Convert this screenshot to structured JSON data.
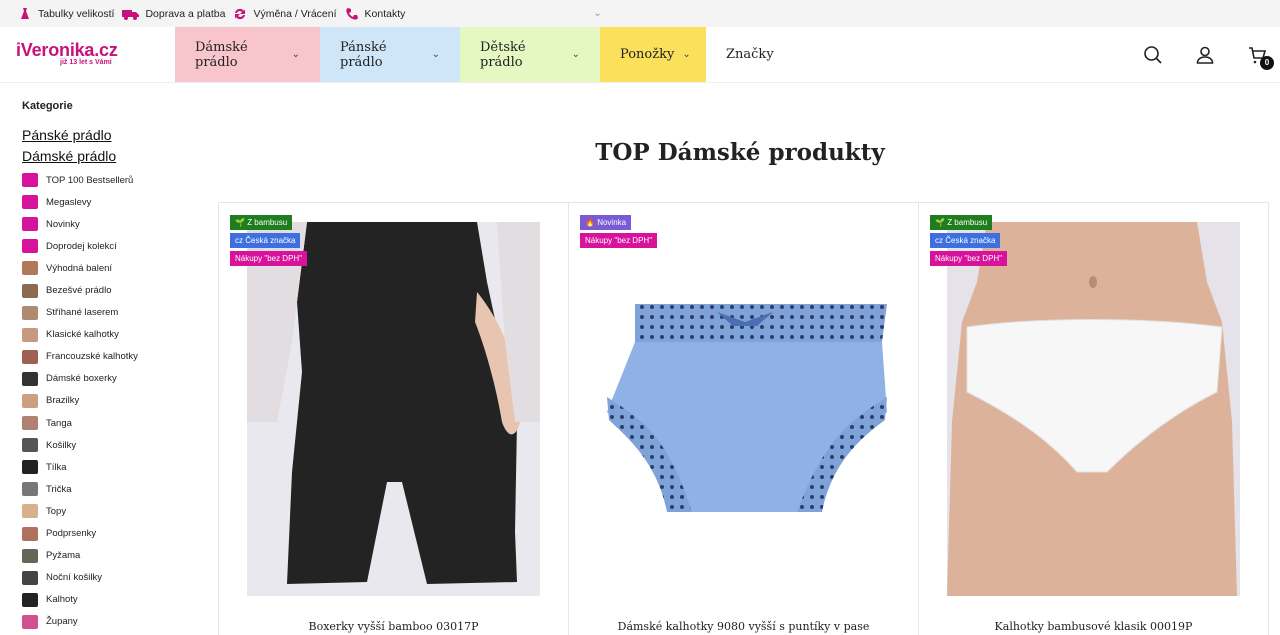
{
  "topbar": {
    "items": [
      {
        "label": "Tabulky velikostí",
        "icon": "dress-icon"
      },
      {
        "label": "Doprava a platba",
        "icon": "truck-icon"
      },
      {
        "label": "Výměna / Vrácení",
        "icon": "exchange-icon"
      },
      {
        "label": "Kontakty",
        "icon": "phone-icon"
      }
    ]
  },
  "logo": {
    "main": "iVeronika.cz",
    "sub": "již 13 let s Vámi"
  },
  "nav": [
    {
      "label": "Dámské prádlo",
      "has_dropdown": true,
      "color": "#f8c5cd"
    },
    {
      "label": "Pánské prádlo",
      "has_dropdown": true,
      "color": "#cfe6f8"
    },
    {
      "label": "Dětské prádlo",
      "has_dropdown": true,
      "color": "#e6f8c2"
    },
    {
      "label": "Ponožky",
      "has_dropdown": true,
      "color": "#fbe05b"
    },
    {
      "label": "Značky",
      "has_dropdown": false,
      "color": "#ffffff"
    }
  ],
  "cart": {
    "count": "0"
  },
  "sidebar": {
    "title": "Kategorie",
    "top_links": [
      "Pánské prádlo",
      "Dámské prádlo"
    ],
    "items": [
      "TOP 100 Bestsellerů",
      "Megaslevy",
      "Novinky",
      "Doprodej kolekcí",
      "Výhodná balení",
      "Bezešvé prádlo",
      "Stříhané laserem",
      "Klasické kalhotky",
      "Francouzské kalhotky",
      "Dámské boxerky",
      "Brazilky",
      "Tanga",
      "Košilky",
      "Tílka",
      "Trička",
      "Topy",
      "Podprsenky",
      "Pyžama",
      "Noční košilky",
      "Kalhoty",
      "Župany"
    ]
  },
  "main": {
    "title": "TOP Dámské produkty",
    "products": [
      {
        "name": "Boxerky vyšší bamboo 03017P",
        "badges": [
          "Z bambusu",
          "cz Česká značka",
          "Nákupy \"bez DPH\""
        ]
      },
      {
        "name": "Dámské kalhotky 9080 vyšší s puntíky v pase",
        "badges": [
          "Novinka",
          "Nákupy \"bez DPH\""
        ]
      },
      {
        "name": "Kalhotky bambusové klasik 00019P",
        "badges": [
          "Z bambusu",
          "cz Česká značka",
          "Nákupy \"bez DPH\""
        ]
      }
    ]
  }
}
